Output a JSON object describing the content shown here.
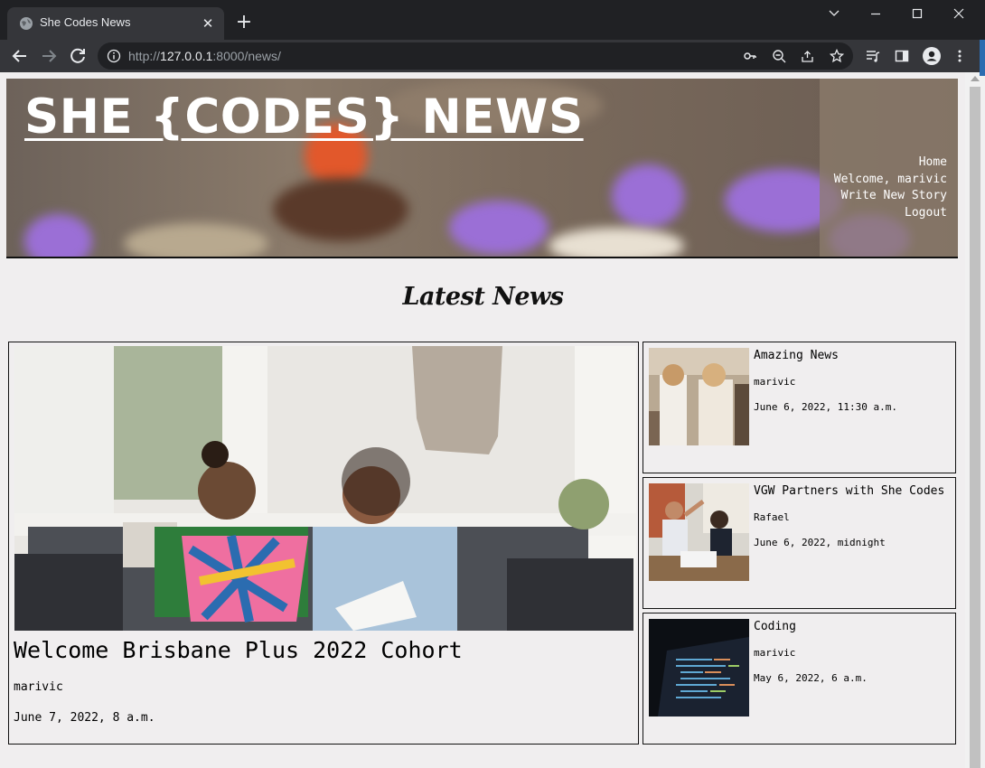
{
  "browser": {
    "tab_title": "She Codes News",
    "tab_close": "✕",
    "new_tab": "+",
    "url_prefix": "http://",
    "url_host": "127.0.0.1",
    "url_rest": ":8000/news/"
  },
  "header": {
    "site_title": "SHE {CODES} NEWS",
    "nav": {
      "home": "Home",
      "welcome": "Welcome, marivic",
      "write": "Write New Story",
      "logout": "Logout"
    }
  },
  "main": {
    "heading": "Latest News",
    "featured": {
      "title": "Welcome Brisbane Plus 2022 Cohort",
      "author": "marivic",
      "date": "June 7, 2022, 8 a.m."
    },
    "stories": [
      {
        "title": "Amazing News",
        "author": "marivic",
        "date": "June 6, 2022, 11:30 a.m."
      },
      {
        "title": "VGW Partners with She Codes",
        "author": "Rafael",
        "date": "June 6, 2022, midnight"
      },
      {
        "title": "Coding",
        "author": "marivic",
        "date": "May 6, 2022, 6 a.m."
      }
    ]
  },
  "colors": {
    "page_bg": "#f0eeef",
    "chrome_dark": "#202124",
    "chrome_toolbar": "#35363a",
    "accent_purple": "#9b6fd6"
  }
}
